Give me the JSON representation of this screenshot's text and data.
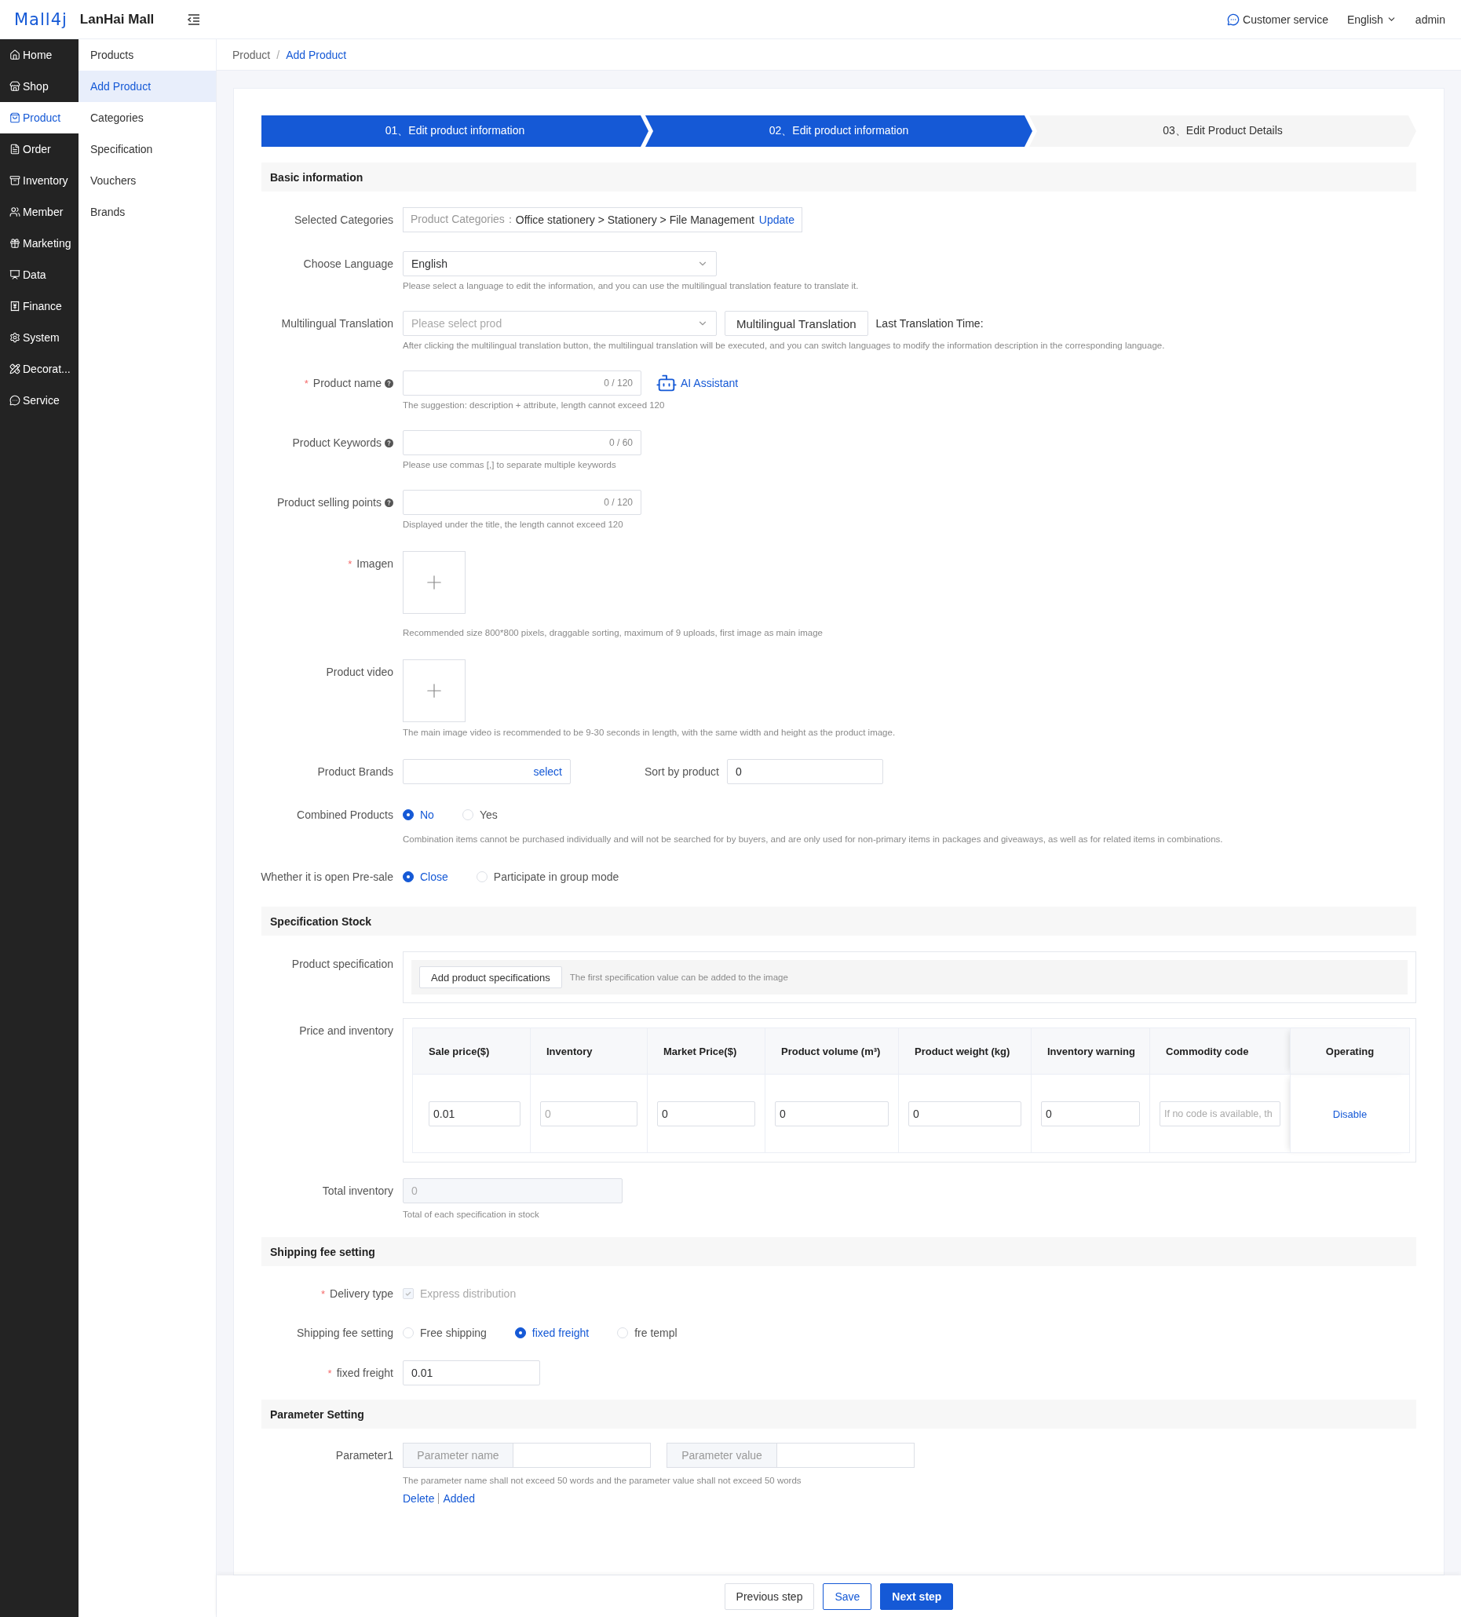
{
  "header": {
    "logo": "Mall4j",
    "app_name": "LanHai Mall",
    "customer_service": "Customer service",
    "language": "English",
    "user": "admin"
  },
  "nav": [
    {
      "label": "Home",
      "selected": false
    },
    {
      "label": "Shop",
      "selected": false
    },
    {
      "label": "Product",
      "selected": true
    },
    {
      "label": "Order",
      "selected": false
    },
    {
      "label": "Inventory",
      "selected": false
    },
    {
      "label": "Member",
      "selected": false
    },
    {
      "label": "Marketing",
      "selected": false
    },
    {
      "label": "Data",
      "selected": false
    },
    {
      "label": "Finance",
      "selected": false
    },
    {
      "label": "System",
      "selected": false
    },
    {
      "label": "Decorat...",
      "selected": false
    },
    {
      "label": "Service",
      "selected": false
    }
  ],
  "subnav": [
    {
      "label": "Products",
      "selected": false
    },
    {
      "label": "Add Product",
      "selected": true
    },
    {
      "label": "Categories",
      "selected": false
    },
    {
      "label": "Specification",
      "selected": false
    },
    {
      "label": "Vouchers",
      "selected": false
    },
    {
      "label": "Brands",
      "selected": false
    }
  ],
  "breadcrumb": {
    "separator": "/",
    "items": [
      {
        "label": "Product",
        "current": false
      },
      {
        "label": "Add Product",
        "current": true
      }
    ]
  },
  "steps": [
    {
      "label": "01、Edit product information",
      "completed": true
    },
    {
      "label": "02、Edit product information",
      "completed": true
    },
    {
      "label": "03、Edit Product Details",
      "completed": false
    }
  ],
  "basic": {
    "title": "Basic information",
    "categories": {
      "label": "Selected Categories",
      "prefix": "Product Categories：",
      "path": "Office stationery > Stationery > File Management",
      "action": "Update"
    },
    "language": {
      "label": "Choose Language",
      "value": "English",
      "hint": "Please select a language to edit the information, and you can use the multilingual translation feature to translate it."
    },
    "translation": {
      "label": "Multilingual Translation",
      "placeholder": "Please select prod",
      "button": "Multilingual Translation",
      "last_time_label": "Last Translation Time:",
      "hint": "After clicking the multilingual translation button, the multilingual translation will be executed, and you can switch languages to modify the information description in the corresponding language."
    },
    "product_name": {
      "marker": "*",
      "label": "Product name",
      "counter": "0 / 120",
      "assistant": "AI Assistant",
      "hint": "The suggestion: description + attribute, length cannot exceed 120"
    },
    "keywords": {
      "label": "Product Keywords",
      "counter": "0 / 60",
      "hint": "Please use commas [,] to separate multiple keywords"
    },
    "selling_points": {
      "label": "Product selling points",
      "counter": "0 / 120",
      "hint": "Displayed under the title, the length cannot exceed 120"
    },
    "image": {
      "marker": "*",
      "label": "Imagen",
      "hint": "Recommended size 800*800 pixels, draggable sorting, maximum of 9 uploads, first image as main image"
    },
    "video": {
      "label": "Product video",
      "hint": "The main image video is recommended to be 9-30 seconds in length, with the same width and height as the product image."
    },
    "brands": {
      "label": "Product Brands",
      "action": "select"
    },
    "sort": {
      "label": "Sort by product",
      "value": "0"
    },
    "combined": {
      "label": "Combined Products",
      "options": [
        {
          "label": "No",
          "selected": true
        },
        {
          "label": "Yes",
          "selected": false
        }
      ],
      "hint": "Combination items cannot be purchased individually and will not be searched for by buyers, and are only used for non-primary items in packages and giveaways, as well as for related items in combinations."
    },
    "presale": {
      "label": "Whether it is open Pre-sale",
      "options": [
        {
          "label": "Close",
          "selected": true
        },
        {
          "label": "Participate in group mode",
          "selected": false
        }
      ]
    }
  },
  "spec": {
    "title": "Specification Stock",
    "product_spec": {
      "label": "Product specification",
      "button": "Add product specifications",
      "hint": "The first specification value can be added to the image"
    },
    "price": {
      "label": "Price and inventory",
      "columns": [
        "Sale price($)",
        "Inventory",
        "Market Price($)",
        "Product volume (m³)",
        "Product weight (kg)",
        "Inventory warning",
        "Commodity code",
        "Operating"
      ],
      "rows": [
        {
          "cells": [
            {
              "value": "0.01"
            },
            {
              "placeholder": "0"
            },
            {
              "value": "0"
            },
            {
              "value": "0"
            },
            {
              "value": "0"
            },
            {
              "value": "0"
            },
            {
              "placeholder": "If no code is available, th"
            }
          ],
          "action": "Disable"
        }
      ]
    },
    "total": {
      "label": "Total inventory",
      "value": "0",
      "hint": "Total of each specification in stock"
    }
  },
  "shipping": {
    "title": "Shipping fee setting",
    "delivery": {
      "marker": "*",
      "label": "Delivery type",
      "option": "Express distribution",
      "checked": true,
      "disabled": true
    },
    "fee": {
      "label": "Shipping fee setting",
      "options": [
        {
          "label": "Free shipping",
          "selected": false
        },
        {
          "label": "fixed freight",
          "selected": true
        },
        {
          "label": "fre templ",
          "selected": false
        }
      ]
    },
    "fixed": {
      "marker": "*",
      "label": "fixed freight",
      "value": "0.01"
    }
  },
  "params": {
    "title": "Parameter Setting",
    "rows": [
      {
        "label": "Parameter1",
        "name_prefix": "Parameter name",
        "value_prefix": "Parameter value"
      }
    ],
    "hint": "The parameter name shall not exceed 50 words and the parameter value shall not exceed 50 words",
    "actions": [
      "Delete",
      "Added"
    ]
  },
  "footer": [
    {
      "label": "Previous step",
      "kind": "default"
    },
    {
      "label": "Save",
      "kind": "outline"
    },
    {
      "label": "Next step",
      "kind": "primary"
    }
  ]
}
